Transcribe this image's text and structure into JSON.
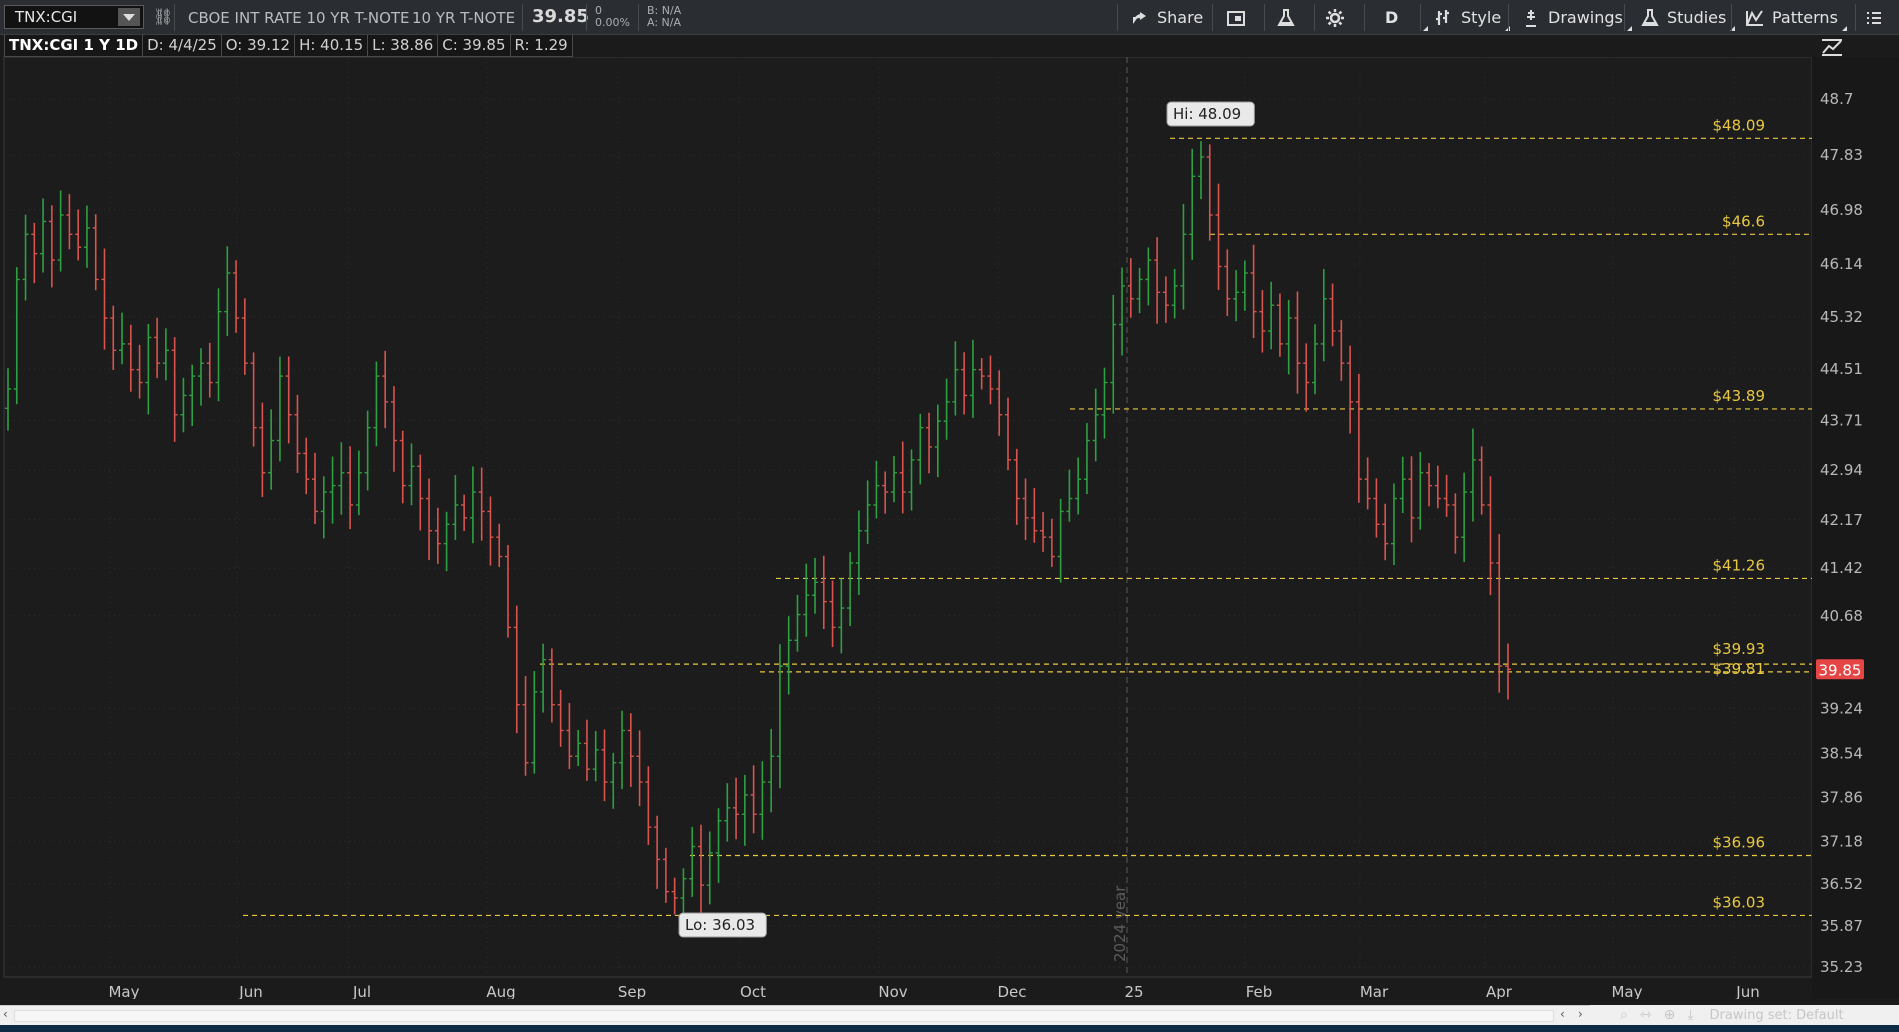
{
  "toolbar": {
    "symbol": "TNX:CGI",
    "description": "CBOE INT RATE 10 YR T-NOTE",
    "short_description": "10 YR T-NOTE",
    "last": "39.85",
    "change": "0",
    "change_pct": "0.00%",
    "bid": "B: N/A",
    "ask": "A: N/A",
    "share_label": "Share",
    "aggregation_label": "D",
    "style_label": "Style",
    "drawings_label": "Drawings",
    "studies_label": "Studies",
    "patterns_label": "Patterns"
  },
  "info_bar": {
    "title": "TNX:CGI 1 Y 1D",
    "date": "D: 4/4/25",
    "open": "O: 39.12",
    "high": "H: 40.15",
    "low": "L: 38.86",
    "close": "C: 39.85",
    "range": "R: 1.29"
  },
  "bottom_bar": {
    "drawing_set": "Drawing set: Default"
  },
  "colors": {
    "up_bar": "#2ea043",
    "down_bar": "#d9534f",
    "level_line": "#e8c840",
    "price_bubble": "#e64545"
  },
  "chart_data": {
    "type": "ohlc",
    "y_axis": {
      "range": [
        35.23,
        48.7
      ],
      "tick_labels": [
        "48.7",
        "47.83",
        "46.98",
        "46.14",
        "45.32",
        "44.51",
        "43.71",
        "42.94",
        "42.17",
        "41.42",
        "40.68",
        "39.24",
        "38.54",
        "37.86",
        "37.18",
        "36.52",
        "35.87",
        "35.23"
      ]
    },
    "x_axis": {
      "tick_labels": [
        "May",
        "Jun",
        "Jul",
        "Aug",
        "Sep",
        "Oct",
        "Nov",
        "Dec",
        "25",
        "Feb",
        "Mar",
        "Apr",
        "May",
        "Jun"
      ]
    },
    "year_separator_label": "2024 year",
    "current_price": "39.85",
    "high_marker": "Hi: 48.09",
    "low_marker": "Lo: 36.03",
    "levels": [
      {
        "label": "$48.09",
        "value": 48.09
      },
      {
        "label": "$46.6",
        "value": 46.6
      },
      {
        "label": "$43.89",
        "value": 43.89
      },
      {
        "label": "$41.26",
        "value": 41.26
      },
      {
        "label": "$39.93",
        "value": 39.93
      },
      {
        "label": "$39.81",
        "value": 39.81
      },
      {
        "label": "$36.96",
        "value": 36.96
      },
      {
        "label": "$36.03",
        "value": 36.03
      }
    ],
    "daily_close_path": [
      44.2,
      45.9,
      46.6,
      46.3,
      46.8,
      46.2,
      46.9,
      46.6,
      46.4,
      46.7,
      45.9,
      45.3,
      44.8,
      44.9,
      44.5,
      44.3,
      45.0,
      44.6,
      44.8,
      43.8,
      44.1,
      44.4,
      44.6,
      44.3,
      45.4,
      46.0,
      45.3,
      44.6,
      43.6,
      42.9,
      43.4,
      44.4,
      43.8,
      43.2,
      42.8,
      42.3,
      42.6,
      42.7,
      42.9,
      42.4,
      42.9,
      43.6,
      44.4,
      44.0,
      43.4,
      42.7,
      43.0,
      42.5,
      42.0,
      41.8,
      42.1,
      42.4,
      42.2,
      42.6,
      42.3,
      41.9,
      41.6,
      40.5,
      39.3,
      38.4,
      39.5,
      40.0,
      39.3,
      38.9,
      38.5,
      38.7,
      38.3,
      38.6,
      38.1,
      38.4,
      38.9,
      38.5,
      38.1,
      37.4,
      36.9,
      36.4,
      36.3,
      36.6,
      37.1,
      36.5,
      37.0,
      37.5,
      37.7,
      37.6,
      37.9,
      37.6,
      38.1,
      38.5,
      39.9,
      40.3,
      40.7,
      41.0,
      41.2,
      40.9,
      40.5,
      40.8,
      41.5,
      42.0,
      42.4,
      42.7,
      42.6,
      42.9,
      42.6,
      43.1,
      43.6,
      43.3,
      43.7,
      44.0,
      44.5,
      44.1,
      44.5,
      44.4,
      44.2,
      43.8,
      43.1,
      42.5,
      42.2,
      42.0,
      41.9,
      41.6,
      42.3,
      42.5,
      42.8,
      43.4,
      43.8,
      44.3,
      45.2,
      45.8,
      45.6,
      45.9,
      46.2,
      45.7,
      45.5,
      45.8,
      46.6,
      47.5,
      47.8,
      46.9,
      46.1,
      45.6,
      45.7,
      46.0,
      45.4,
      45.1,
      45.5,
      44.9,
      45.3,
      44.6,
      44.3,
      44.9,
      45.6,
      45.1,
      44.6,
      44.0,
      42.8,
      42.5,
      42.1,
      41.8,
      42.5,
      42.8,
      42.2,
      42.9,
      42.7,
      42.5,
      42.4,
      41.9,
      42.6,
      43.1,
      42.4,
      41.5,
      39.9,
      39.85
    ]
  }
}
